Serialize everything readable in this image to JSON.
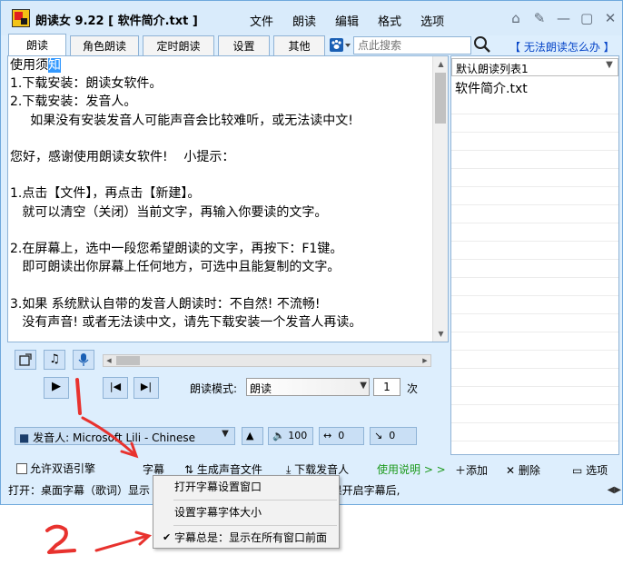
{
  "titlebar": {
    "title": "朗读女 9.22 [ 软件简介.txt ]",
    "menu": [
      "文件",
      "朗读",
      "编辑",
      "格式",
      "选项"
    ],
    "icons": [
      "home-icon",
      "tools-icon",
      "minimize-icon",
      "restore-icon",
      "close-icon"
    ],
    "glyphs": [
      "⌂",
      "✎",
      "—",
      "▢",
      "✕"
    ]
  },
  "tabs": [
    "朗读",
    "角色朗读",
    "定时朗读",
    "设置",
    "其他"
  ],
  "search": {
    "placeholder": "点此搜索"
  },
  "help_link": "【 无法朗读怎么办 】",
  "editor": {
    "line1_before": "使用须",
    "line1_selected": "知",
    "lines": [
      "1.下载安装：朗读女软件。",
      "2.下载安装：发音人。",
      "     如果没有安装发音人可能声音会比较难听，或无法读中文!",
      "",
      "您好，感谢使用朗读女软件!    小提示：",
      "",
      "1.点击【文件】，再点击【新建】。",
      "   就可以清空（关闭）当前文字，再输入你要读的文字。",
      "",
      "2.在屏幕上，选中一段您希望朗读的文字，再按下：F1键。",
      "   即可朗读出你屏幕上任何地方，可选中且能复制的文字。",
      "",
      "3.如果 系统默认自带的发音人朗读时：不自然! 不流畅!",
      "   没有声音! 或者无法读中文，请先下载安装一个发音人再读。"
    ]
  },
  "playlist": {
    "selected": "默认朗读列表1",
    "items": [
      "软件简介.txt"
    ]
  },
  "controls": {
    "mode_label": "朗读模式:",
    "mode_value": "朗读",
    "count_value": "1",
    "count_unit": "次",
    "voice_value": "发音人: Microsoft Lili - Chinese",
    "volume": "100",
    "speed": "0",
    "pitch": "0"
  },
  "options": {
    "bilingual_label": "允许双语引擎",
    "subtitle_label": "字幕",
    "generate_audio_label": "生成声音文件",
    "download_voice_label": "下载发音人",
    "instructions_label": "使用说明 > >"
  },
  "playlist_actions": {
    "add_label": "添加",
    "delete_label": "删除",
    "options_label": "选项"
  },
  "status": {
    "text": "打开：桌面字幕（歌词）显示                                   字幕设置。 其他：设置字幕字体（如果开启字幕后,"
  },
  "context_menu": {
    "items": [
      "打开字幕设置窗口",
      "设置字幕字体大小",
      "字幕总是：显示在所有窗口前面"
    ]
  },
  "colors": {
    "window_bg": "#ddeefd",
    "accent": "#1a5fb4",
    "selection": "#3399ff",
    "annotation_red": "#e8322e",
    "link_green": "#1c9a1c"
  }
}
